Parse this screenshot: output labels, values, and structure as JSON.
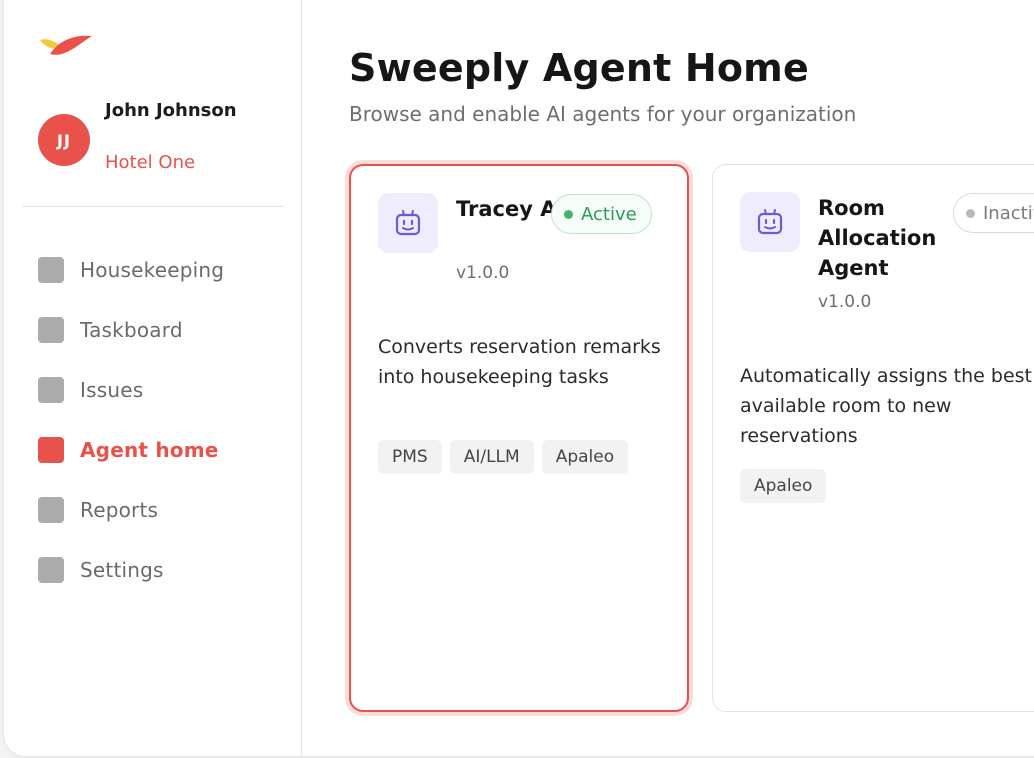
{
  "app": {
    "brand_colors": {
      "accent": "#e8524a",
      "logo_yellow": "#f6c63c",
      "active_green": "#2f9a55"
    },
    "logo_icon": "bird-logo-icon"
  },
  "user": {
    "initials": "JJ",
    "name": "John Johnson",
    "organization": "Hotel One"
  },
  "sidebar": {
    "items": [
      {
        "label": "Housekeeping",
        "active": false
      },
      {
        "label": "Taskboard",
        "active": false
      },
      {
        "label": "Issues",
        "active": false
      },
      {
        "label": "Agent home",
        "active": true
      },
      {
        "label": "Reports",
        "active": false
      },
      {
        "label": "Settings",
        "active": false
      }
    ]
  },
  "header": {
    "title": "Sweeply Agent Home",
    "subtitle": "Browse and enable AI agents for your organization"
  },
  "agents": [
    {
      "name": "Tracey Agent",
      "status": "Active",
      "version": "v1.0.0",
      "description": "Converts reservation remarks into housekeeping tasks",
      "tags": [
        "PMS",
        "AI/LLM",
        "Apaleo"
      ],
      "icon": "robot-icon"
    },
    {
      "name": "Room Allocation Agent",
      "status": "Inactive",
      "version": "v1.0.0",
      "description": "Automatically assigns the best available room to new reservations",
      "tags": [
        "Apaleo"
      ],
      "icon": "robot-icon"
    }
  ]
}
